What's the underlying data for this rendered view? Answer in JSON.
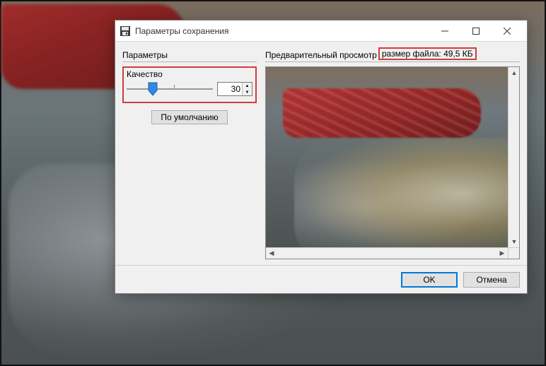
{
  "window": {
    "title": "Параметры сохранения"
  },
  "params": {
    "section_label": "Параметры",
    "quality_label": "Качество",
    "quality_value": "30",
    "quality_min": 0,
    "quality_max": 100,
    "default_button": "По умолчанию"
  },
  "preview": {
    "section_label": "Предварительный просмотр",
    "filesize_label": "размер файла: 49,5 КБ"
  },
  "footer": {
    "ok": "OK",
    "cancel": "Отмена"
  },
  "highlight_color": "#d23c3c"
}
